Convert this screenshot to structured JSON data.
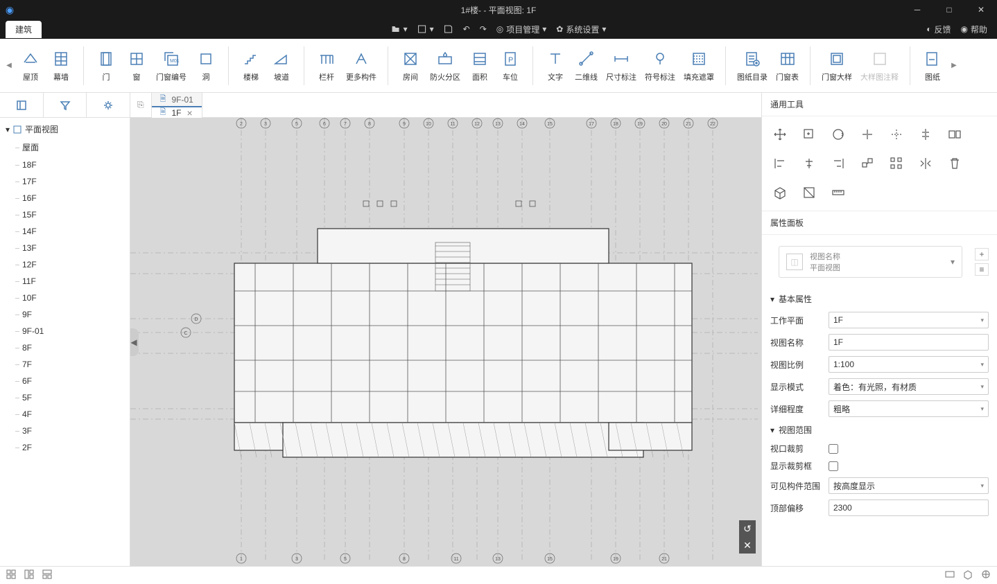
{
  "window": {
    "title": "1#楼- - 平面视图: 1F"
  },
  "mainTab": "建筑",
  "menubar": {
    "project": "项目管理",
    "system": "系统设置",
    "feedback": "反馈",
    "help": "帮助"
  },
  "ribbon": {
    "roof": "屋顶",
    "curtain": "幕墙",
    "door": "门",
    "window": "窗",
    "dwnum": "门窗编号",
    "hole": "洞",
    "stair": "楼梯",
    "ramp": "坡道",
    "rail": "栏杆",
    "more": "更多构件",
    "room": "房间",
    "fire": "防火分区",
    "area": "面积",
    "parking": "车位",
    "text": "文字",
    "line2d": "二维线",
    "dim": "尺寸标注",
    "symbol": "符号标注",
    "fill": "填充遮罩",
    "sheetdir": "图纸目录",
    "dwtable": "门窗表",
    "dwdetail": "门窗大样",
    "detailnote": "大样图注释",
    "sheet": "图纸"
  },
  "tabs": [
    {
      "label": "9F-01",
      "active": false
    },
    {
      "label": "1F",
      "active": true
    }
  ],
  "tree": {
    "root": "平面视图",
    "items": [
      "屋面",
      "18F",
      "17F",
      "16F",
      "15F",
      "14F",
      "13F",
      "12F",
      "11F",
      "10F",
      "9F",
      "9F-01",
      "8F",
      "7F",
      "6F",
      "5F",
      "4F",
      "3F",
      "2F"
    ]
  },
  "rightPanel": {
    "tools": "通用工具",
    "propPanel": "属性面板",
    "viewNameLabel": "视图名称",
    "viewTypeLabel": "平面视图",
    "groups": {
      "basic": "基本属性",
      "range": "视图范围"
    },
    "props": {
      "workplane": {
        "label": "工作平面",
        "value": "1F"
      },
      "viewname": {
        "label": "视图名称",
        "value": "1F"
      },
      "scale": {
        "label": "视图比例",
        "value": "1:100"
      },
      "display": {
        "label": "显示模式",
        "value": "着色：有光照，有材质"
      },
      "detail": {
        "label": "详细程度",
        "value": "粗略"
      },
      "crop": {
        "label": "视口裁剪"
      },
      "showcrop": {
        "label": "显示裁剪框"
      },
      "visrange": {
        "label": "可见构件范围",
        "value": "按高度显示"
      },
      "topoffset": {
        "label": "顶部偏移",
        "value": "2300"
      }
    }
  },
  "gridLabels": {
    "top": [
      "2",
      "3",
      "5",
      "6",
      "7",
      "8",
      "9",
      "10",
      "11",
      "12",
      "13",
      "14",
      "15",
      "17",
      "18",
      "19",
      "20",
      "21",
      "22"
    ],
    "bottom": [
      "1",
      "3",
      "5",
      "8",
      "11",
      "13",
      "15",
      "19",
      "21"
    ],
    "left": [
      "D",
      "C"
    ]
  }
}
